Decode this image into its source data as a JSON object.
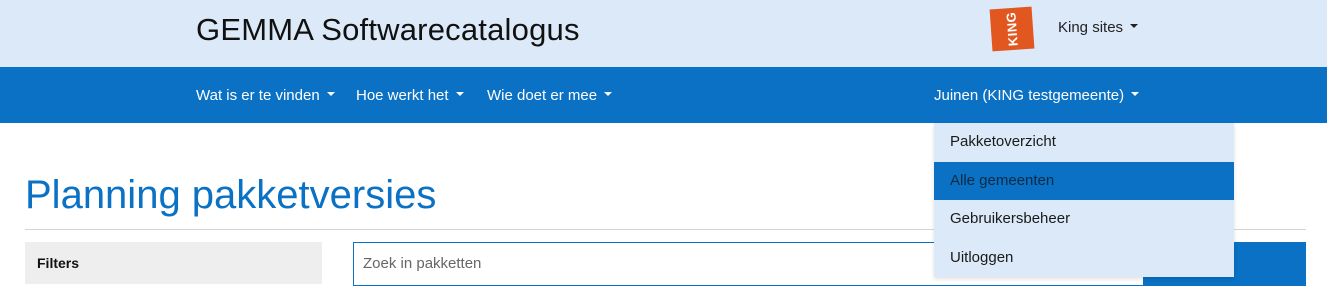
{
  "header": {
    "site_title": "GEMMA Softwarecatalogus",
    "logo_text": "KING",
    "logo_color": "#e2561f",
    "king_sites_label": "King sites"
  },
  "nav": {
    "items": [
      {
        "label": "Wat is er te vinden"
      },
      {
        "label": "Hoe werkt het"
      },
      {
        "label": "Wie doet er mee"
      }
    ],
    "user_menu_label": "Juinen (KING testgemeente)"
  },
  "user_dropdown": {
    "items": [
      {
        "label": "Pakketoverzicht",
        "active": false
      },
      {
        "label": "Alle gemeenten",
        "active": true
      },
      {
        "label": "Gebruikersbeheer",
        "active": false
      },
      {
        "label": "Uitloggen",
        "active": false
      }
    ]
  },
  "main": {
    "page_title": "Planning pakketversies",
    "filters_label": "Filters",
    "search": {
      "placeholder": "Zoek in pakketten",
      "value": ""
    }
  },
  "colors": {
    "primary_blue": "#0a71c4",
    "header_bg": "#dce9f8",
    "filters_bg": "#eeeeee"
  }
}
